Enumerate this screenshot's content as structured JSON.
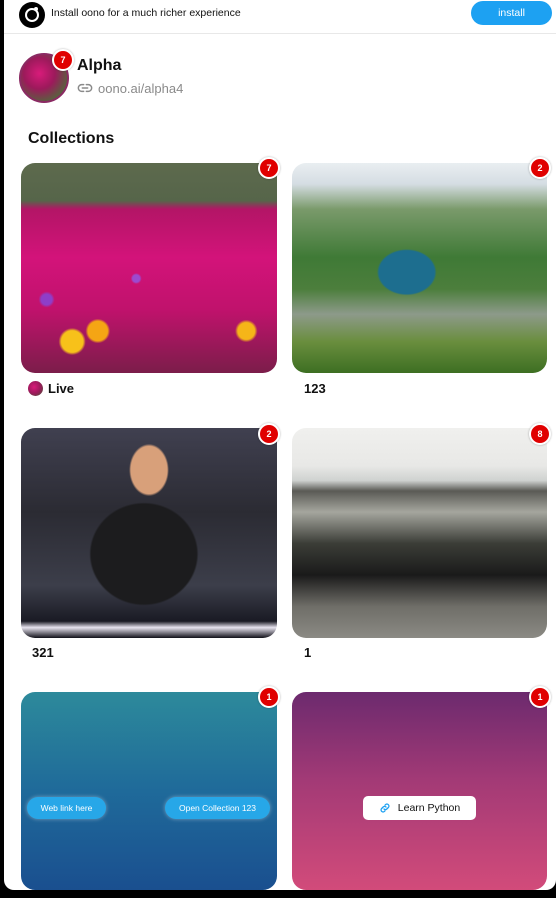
{
  "banner": {
    "message": "Install oono for a much richer experience",
    "install_label": "install",
    "logo_icon": "oono-logo-icon"
  },
  "profile": {
    "name": "Alpha",
    "link": "oono.ai/alpha4",
    "badge_count": "7",
    "link_icon": "link-icon"
  },
  "section": {
    "title": "Collections"
  },
  "collections": [
    {
      "caption": "Live",
      "badge": "7",
      "has_avatar": true
    },
    {
      "caption": "123",
      "badge": "2"
    },
    {
      "caption": "321",
      "badge": "2"
    },
    {
      "caption": "1",
      "badge": "8"
    },
    {
      "caption": "",
      "badge": "1",
      "buttons": [
        "Web link here",
        "Open Collection 123"
      ]
    },
    {
      "caption": "",
      "badge": "1",
      "link_button": "Learn Python"
    }
  ],
  "colors": {
    "accent": "#1da1f2",
    "badge": "#e00000",
    "avatar_ring": "#8b2a63"
  }
}
